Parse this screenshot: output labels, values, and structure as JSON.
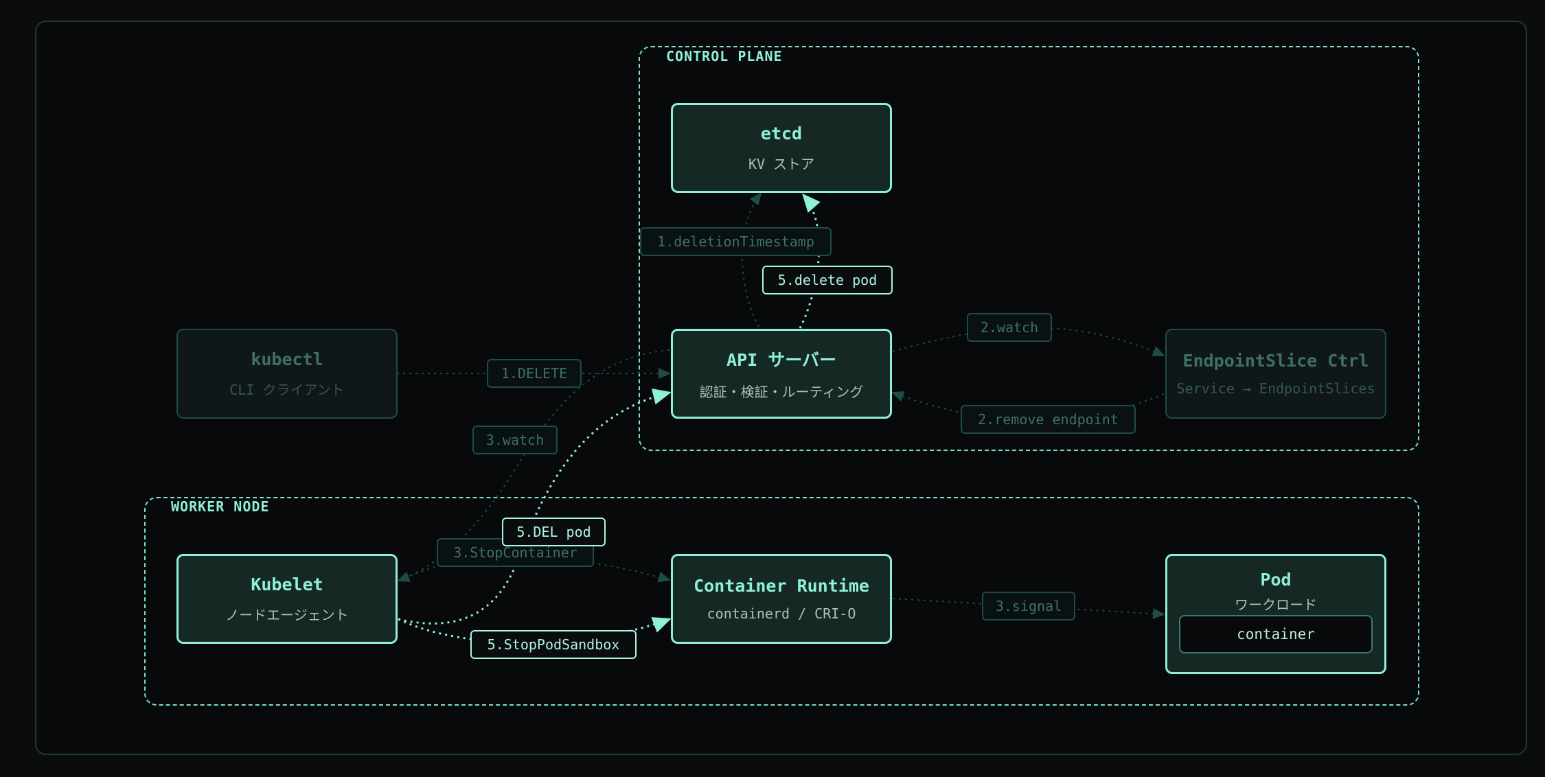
{
  "regions": {
    "control_plane": "CONTROL PLANE",
    "worker_node": "WORKER NODE"
  },
  "nodes": {
    "etcd": {
      "title": "etcd",
      "subtitle": "KV ストア"
    },
    "api": {
      "title": "API サーバー",
      "subtitle": "認証・検証・ルーティング"
    },
    "kubectl": {
      "title": "kubectl",
      "subtitle": "CLI クライアント"
    },
    "endpointslice": {
      "title": "EndpointSlice Ctrl",
      "subtitle": "Service → EndpointSlices"
    },
    "kubelet": {
      "title": "Kubelet",
      "subtitle": "ノードエージェント"
    },
    "runtime": {
      "title": "Container Runtime",
      "subtitle": "containerd / CRI-O"
    },
    "pod": {
      "title": "Pod",
      "subtitle": "ワークロード",
      "inner": "container"
    }
  },
  "edge_labels": {
    "deletion_timestamp": "1.deletionTimestamp",
    "delete_pod": "5.delete pod",
    "watch_2": "2.watch",
    "delete": "1.DELETE",
    "remove_endpoint": "2.remove endpoint",
    "watch_3": "3.watch",
    "del_pod": "5.DEL pod",
    "stop_container": "3.StopContainer",
    "stop_pod_sandbox": "5.StopPodSandbox",
    "signal": "3.signal"
  },
  "colors": {
    "accent": "#8ef0d6",
    "dim": "#1f4d44",
    "background": "#0a0c0e"
  }
}
